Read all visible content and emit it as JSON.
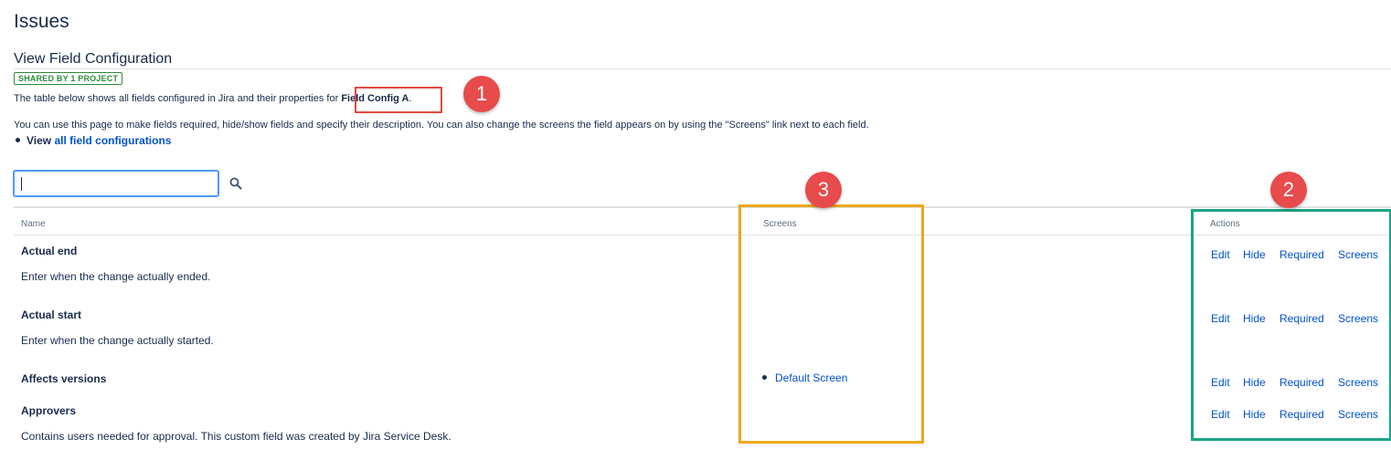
{
  "header": {
    "title": "Issues"
  },
  "section": {
    "title": "View Field Configuration",
    "badge": "SHARED BY 1 PROJECT",
    "intro_prefix": "The table below shows all fields configured in Jira and their properties for ",
    "config_name": "Field Config A",
    "intro_suffix": ".",
    "help_text": "You can use this page to make fields required, hide/show fields and specify their description. You can also change the screens the field appears on by using the \"Screens\" link next to each field.",
    "view_prefix": "View ",
    "view_link": "all field configurations"
  },
  "search": {
    "value": "",
    "placeholder": ""
  },
  "table": {
    "columns": {
      "name": "Name",
      "screens": "Screens",
      "actions": "Actions"
    },
    "action_labels": {
      "edit": "Edit",
      "hide": "Hide",
      "required": "Required",
      "screens": "Screens"
    },
    "rows": [
      {
        "name": "Actual end",
        "description": "Enter when the change actually ended.",
        "screens": []
      },
      {
        "name": "Actual start",
        "description": "Enter when the change actually started.",
        "screens": []
      },
      {
        "name": "Affects versions",
        "description": "",
        "screens": [
          "Default Screen"
        ]
      },
      {
        "name": "Approvers",
        "description": "Contains users needed for approval. This custom field was created by Jira Service Desk.",
        "screens": []
      }
    ]
  },
  "annotations": {
    "marker_1": "1",
    "marker_2": "2",
    "marker_3": "3",
    "colors": {
      "marker": "#e84b4b",
      "box_1": "#e5483f",
      "box_2": "#1aa386",
      "box_3": "#eda719"
    }
  }
}
